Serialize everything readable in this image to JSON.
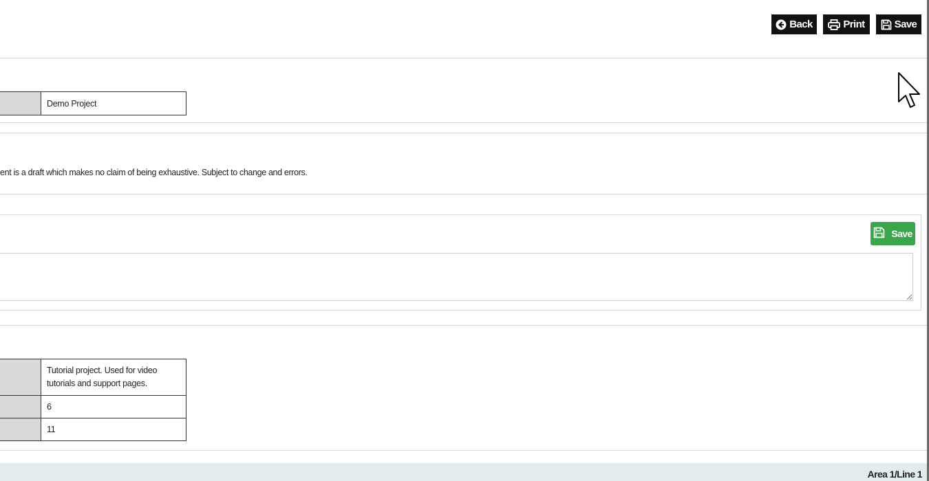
{
  "toolbar": {
    "back_label": "Back",
    "print_label": "Print",
    "save_label": "Save"
  },
  "project": {
    "name": "Demo Project"
  },
  "notice": {
    "text": "ent is a draft which makes no claim of being exhaustive. Subject to change and errors."
  },
  "notes": {
    "save_label": "Save",
    "value": "",
    "placeholder": ""
  },
  "details": {
    "description": "Tutorial project. Used for video tutorials and support pages.",
    "count_a": "6",
    "count_b": "11"
  },
  "footer": {
    "location": "Area 1/Line 1"
  },
  "colors": {
    "toolbar_button": "#111111",
    "save_green": "#3aa54a",
    "footer_bg": "#e2ecee",
    "label_cell": "#d9d9d9"
  }
}
